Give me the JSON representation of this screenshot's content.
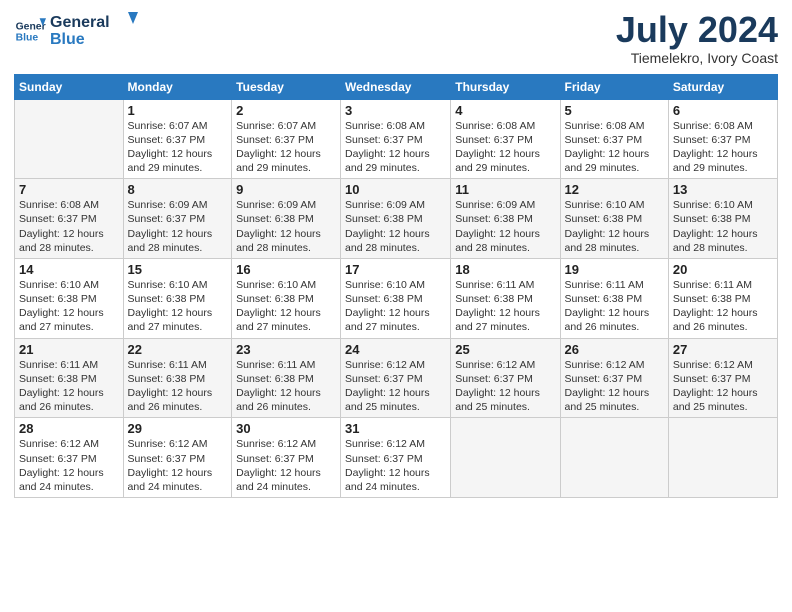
{
  "header": {
    "logo_line1": "General",
    "logo_line2": "Blue",
    "month": "July 2024",
    "location": "Tiemelekro, Ivory Coast"
  },
  "days_of_week": [
    "Sunday",
    "Monday",
    "Tuesday",
    "Wednesday",
    "Thursday",
    "Friday",
    "Saturday"
  ],
  "weeks": [
    [
      {
        "day": "",
        "info": ""
      },
      {
        "day": "1",
        "info": "Sunrise: 6:07 AM\nSunset: 6:37 PM\nDaylight: 12 hours\nand 29 minutes."
      },
      {
        "day": "2",
        "info": "Sunrise: 6:07 AM\nSunset: 6:37 PM\nDaylight: 12 hours\nand 29 minutes."
      },
      {
        "day": "3",
        "info": "Sunrise: 6:08 AM\nSunset: 6:37 PM\nDaylight: 12 hours\nand 29 minutes."
      },
      {
        "day": "4",
        "info": "Sunrise: 6:08 AM\nSunset: 6:37 PM\nDaylight: 12 hours\nand 29 minutes."
      },
      {
        "day": "5",
        "info": "Sunrise: 6:08 AM\nSunset: 6:37 PM\nDaylight: 12 hours\nand 29 minutes."
      },
      {
        "day": "6",
        "info": "Sunrise: 6:08 AM\nSunset: 6:37 PM\nDaylight: 12 hours\nand 29 minutes."
      }
    ],
    [
      {
        "day": "7",
        "info": "Sunrise: 6:08 AM\nSunset: 6:37 PM\nDaylight: 12 hours\nand 28 minutes."
      },
      {
        "day": "8",
        "info": "Sunrise: 6:09 AM\nSunset: 6:37 PM\nDaylight: 12 hours\nand 28 minutes."
      },
      {
        "day": "9",
        "info": "Sunrise: 6:09 AM\nSunset: 6:38 PM\nDaylight: 12 hours\nand 28 minutes."
      },
      {
        "day": "10",
        "info": "Sunrise: 6:09 AM\nSunset: 6:38 PM\nDaylight: 12 hours\nand 28 minutes."
      },
      {
        "day": "11",
        "info": "Sunrise: 6:09 AM\nSunset: 6:38 PM\nDaylight: 12 hours\nand 28 minutes."
      },
      {
        "day": "12",
        "info": "Sunrise: 6:10 AM\nSunset: 6:38 PM\nDaylight: 12 hours\nand 28 minutes."
      },
      {
        "day": "13",
        "info": "Sunrise: 6:10 AM\nSunset: 6:38 PM\nDaylight: 12 hours\nand 28 minutes."
      }
    ],
    [
      {
        "day": "14",
        "info": "Sunrise: 6:10 AM\nSunset: 6:38 PM\nDaylight: 12 hours\nand 27 minutes."
      },
      {
        "day": "15",
        "info": "Sunrise: 6:10 AM\nSunset: 6:38 PM\nDaylight: 12 hours\nand 27 minutes."
      },
      {
        "day": "16",
        "info": "Sunrise: 6:10 AM\nSunset: 6:38 PM\nDaylight: 12 hours\nand 27 minutes."
      },
      {
        "day": "17",
        "info": "Sunrise: 6:10 AM\nSunset: 6:38 PM\nDaylight: 12 hours\nand 27 minutes."
      },
      {
        "day": "18",
        "info": "Sunrise: 6:11 AM\nSunset: 6:38 PM\nDaylight: 12 hours\nand 27 minutes."
      },
      {
        "day": "19",
        "info": "Sunrise: 6:11 AM\nSunset: 6:38 PM\nDaylight: 12 hours\nand 26 minutes."
      },
      {
        "day": "20",
        "info": "Sunrise: 6:11 AM\nSunset: 6:38 PM\nDaylight: 12 hours\nand 26 minutes."
      }
    ],
    [
      {
        "day": "21",
        "info": "Sunrise: 6:11 AM\nSunset: 6:38 PM\nDaylight: 12 hours\nand 26 minutes."
      },
      {
        "day": "22",
        "info": "Sunrise: 6:11 AM\nSunset: 6:38 PM\nDaylight: 12 hours\nand 26 minutes."
      },
      {
        "day": "23",
        "info": "Sunrise: 6:11 AM\nSunset: 6:38 PM\nDaylight: 12 hours\nand 26 minutes."
      },
      {
        "day": "24",
        "info": "Sunrise: 6:12 AM\nSunset: 6:37 PM\nDaylight: 12 hours\nand 25 minutes."
      },
      {
        "day": "25",
        "info": "Sunrise: 6:12 AM\nSunset: 6:37 PM\nDaylight: 12 hours\nand 25 minutes."
      },
      {
        "day": "26",
        "info": "Sunrise: 6:12 AM\nSunset: 6:37 PM\nDaylight: 12 hours\nand 25 minutes."
      },
      {
        "day": "27",
        "info": "Sunrise: 6:12 AM\nSunset: 6:37 PM\nDaylight: 12 hours\nand 25 minutes."
      }
    ],
    [
      {
        "day": "28",
        "info": "Sunrise: 6:12 AM\nSunset: 6:37 PM\nDaylight: 12 hours\nand 24 minutes."
      },
      {
        "day": "29",
        "info": "Sunrise: 6:12 AM\nSunset: 6:37 PM\nDaylight: 12 hours\nand 24 minutes."
      },
      {
        "day": "30",
        "info": "Sunrise: 6:12 AM\nSunset: 6:37 PM\nDaylight: 12 hours\nand 24 minutes."
      },
      {
        "day": "31",
        "info": "Sunrise: 6:12 AM\nSunset: 6:37 PM\nDaylight: 12 hours\nand 24 minutes."
      },
      {
        "day": "",
        "info": ""
      },
      {
        "day": "",
        "info": ""
      },
      {
        "day": "",
        "info": ""
      }
    ]
  ]
}
